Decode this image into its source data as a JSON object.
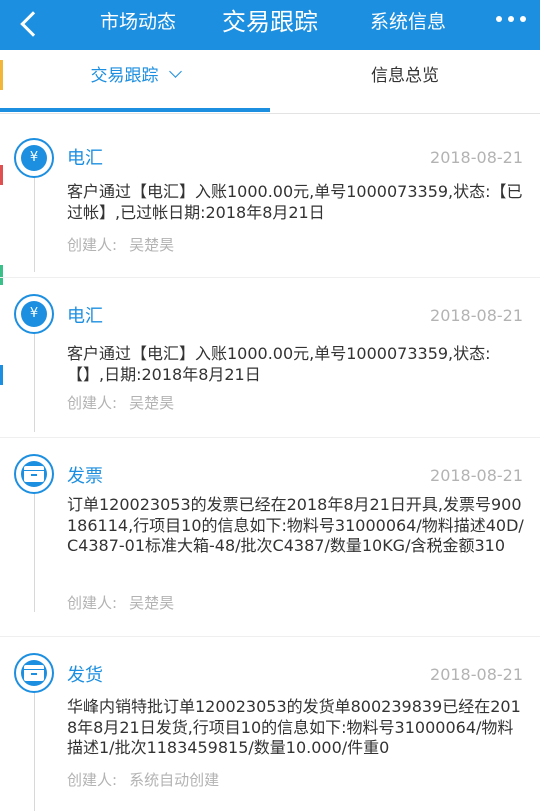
{
  "header": {
    "nav_left": "市场动态",
    "nav_center": "交易跟踪",
    "nav_right": "系统信息",
    "background": "#1d8fe0"
  },
  "tabs": [
    {
      "label": "交易跟踪",
      "active": true
    },
    {
      "label": "信息总览",
      "active": false
    }
  ],
  "items": [
    {
      "icon": "yen-refresh-icon",
      "title": "电汇",
      "date": "2018-08-21",
      "body": "客户通过【电汇】入账1000.00元,单号1000073359,状态:【已过帐】,已过帐日期:2018年8月21日",
      "creator_label": "创建人:",
      "creator": "吴楚昊"
    },
    {
      "icon": "yen-refresh-icon",
      "title": "电汇",
      "date": "2018-08-21",
      "body": "客户通过【电汇】入账1000.00元,单号1000073359,状态:【】,日期:2018年8月21日",
      "creator_label": "创建人:",
      "creator": "吴楚昊"
    },
    {
      "icon": "invoice-box-icon",
      "title": "发票",
      "date": "2018-08-21",
      "body": "订单120023053的发票已经在2018年8月21日开具,发票号900186114,行项目10的信息如下:物料号31000064/物料描述40D/C4387-01标准大箱-48/批次C4387/数量10KG/含税金额310",
      "creator_label": "创建人:",
      "creator": "吴楚昊"
    },
    {
      "icon": "shipment-box-icon",
      "title": "发货",
      "date": "2018-08-21",
      "body": "华峰内销特批订单120023053的发货单800239839已经在2018年8月21日发货,行项目10的信息如下:物料号31000064/物料描述1/批次1183459815/数量10.000/件重0",
      "creator_label": "创建人:",
      "creator": "系统自动创建"
    }
  ]
}
